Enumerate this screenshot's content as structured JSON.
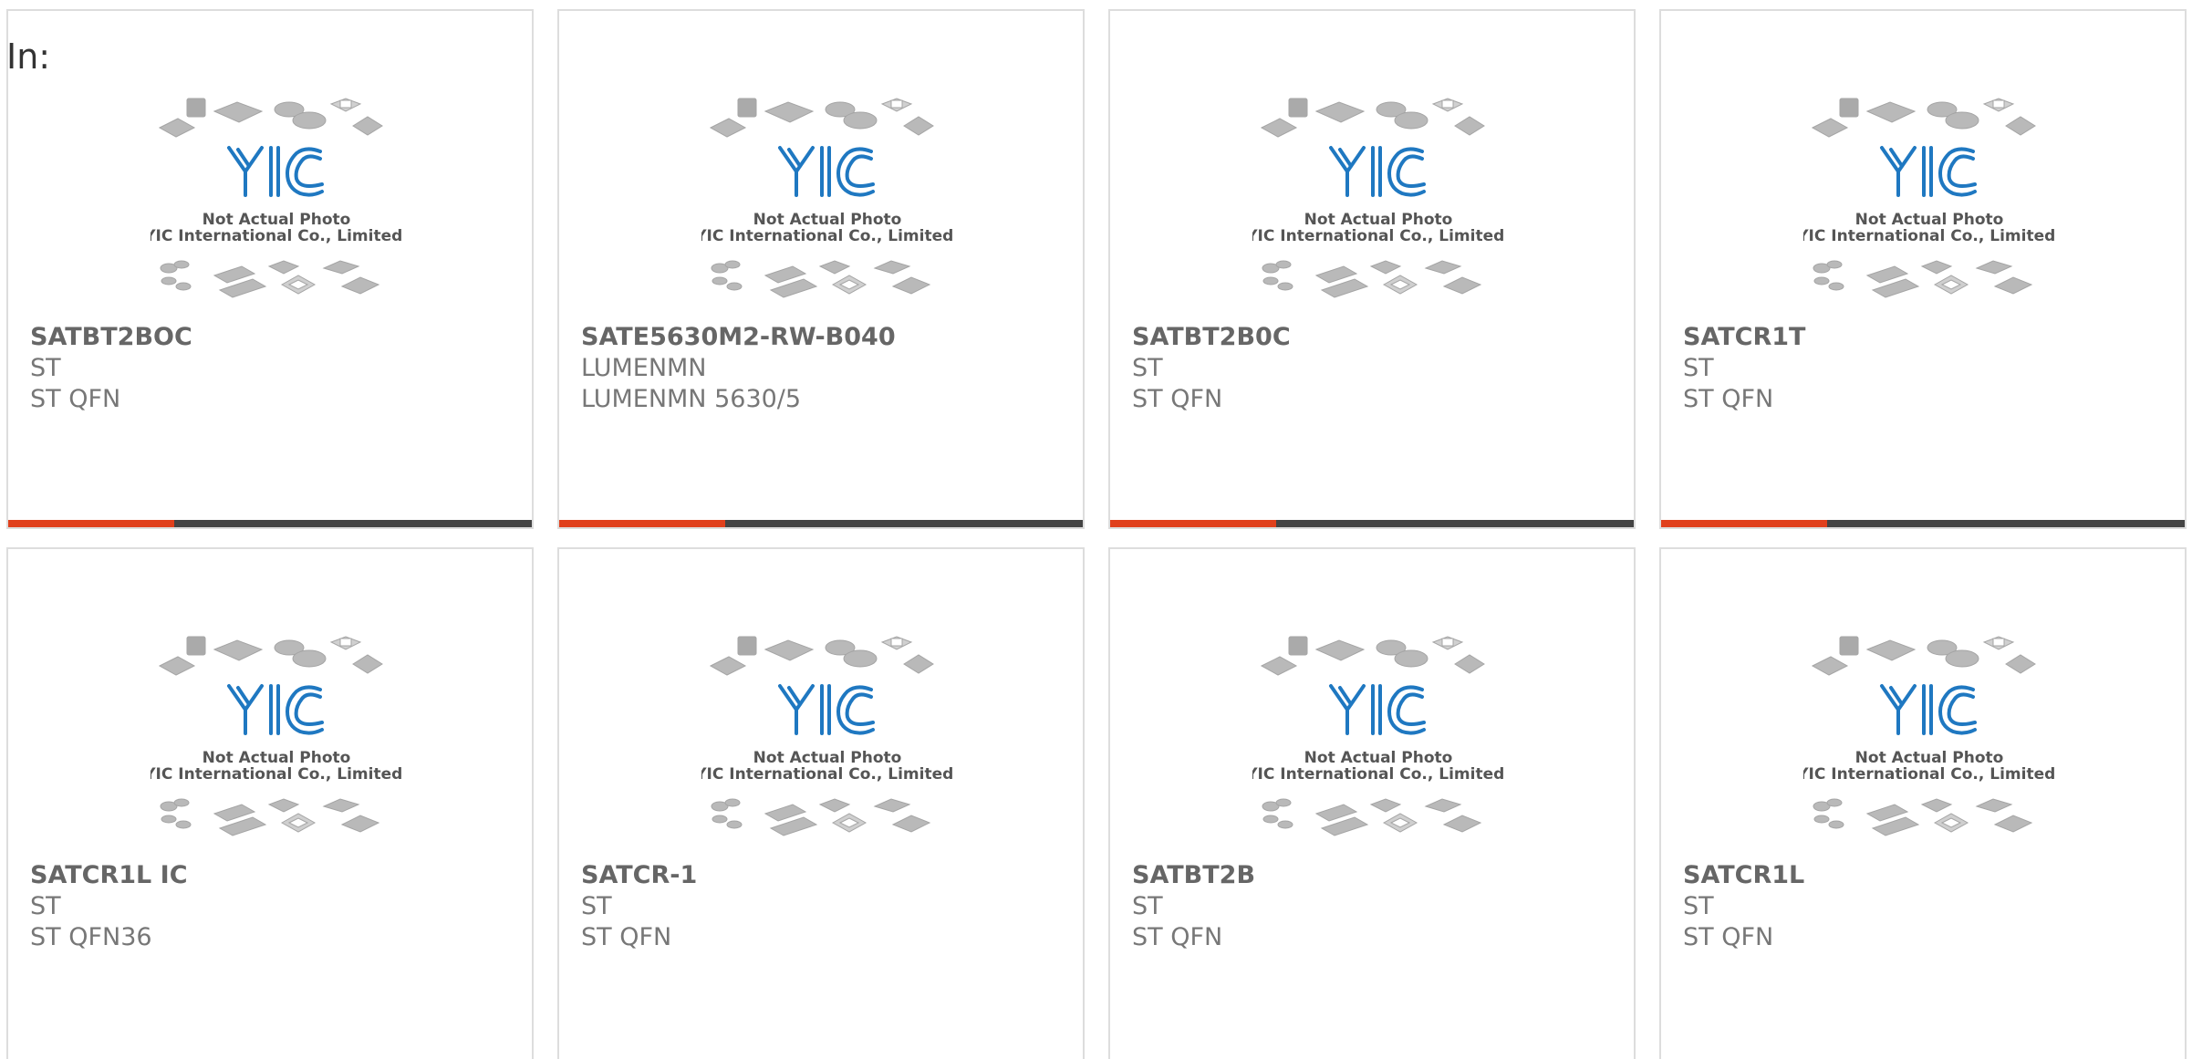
{
  "header": {
    "in_label": "In:"
  },
  "placeholder": {
    "logo_text": "YIC",
    "line1": "Not Actual Photo",
    "line2": "YIC International Co., Limited."
  },
  "colors": {
    "accent": "#e0401c",
    "bar": "#444444",
    "logo": "#1f78c1"
  },
  "products": [
    {
      "name": "SATBT2BOC",
      "maker": "ST",
      "package": "ST QFN"
    },
    {
      "name": "SATE5630M2-RW-B040",
      "maker": "LUMENMN",
      "package": "LUMENMN 5630/5"
    },
    {
      "name": "SATBT2B0C",
      "maker": "ST",
      "package": "ST QFN"
    },
    {
      "name": "SATCR1T",
      "maker": "ST",
      "package": "ST QFN"
    },
    {
      "name": "SATCR1L IC",
      "maker": "ST",
      "package": "ST QFN36"
    },
    {
      "name": "SATCR-1",
      "maker": "ST",
      "package": "ST QFN"
    },
    {
      "name": "SATBT2B",
      "maker": "ST",
      "package": "ST QFN"
    },
    {
      "name": "SATCR1L",
      "maker": "ST",
      "package": "ST QFN"
    }
  ]
}
